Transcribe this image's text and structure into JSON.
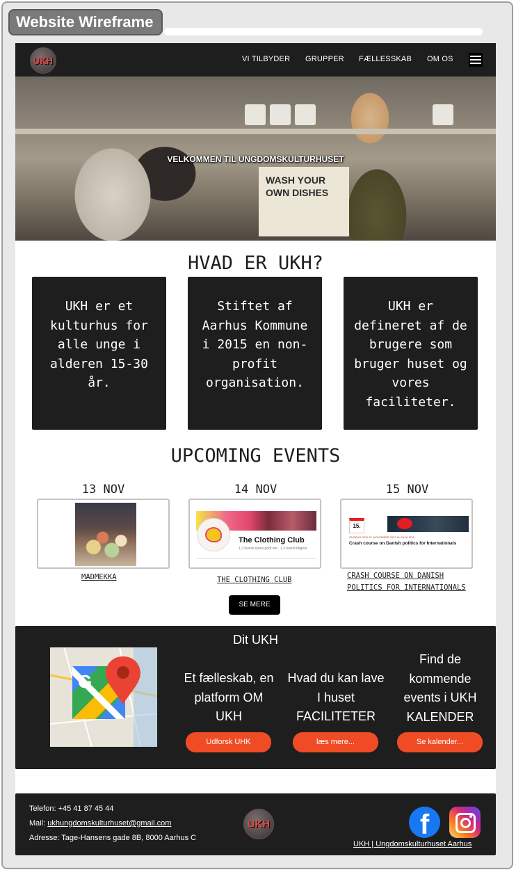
{
  "wireframe": {
    "label": "Website Wireframe"
  },
  "nav": {
    "logo_text": "UKH",
    "links": [
      "VI TILBYDER",
      "GRUPPER",
      "FÆLLESSKAB",
      "OM OS"
    ]
  },
  "hero": {
    "title": "VELKOMMEN TIL UNGDOMSKULTURHUSET",
    "sign_text": "WASH YOUR OWN DISHES"
  },
  "about": {
    "title": "HVAD ER UKH?",
    "boxes": [
      "UKH er et kulturhus for alle unge i alderen 15-30 år.",
      "Stiftet af Aarhus Kommune i 2015 en non-profit organisation.",
      "UKH er defineret af de brugere som bruger huset og vores faciliteter."
    ]
  },
  "events": {
    "title": "UPCOMING EVENTS",
    "items": [
      {
        "date": "13 NOV",
        "name": "MADMEKKA"
      },
      {
        "date": "14 NOV",
        "name": "THE CLOTHING CLUB",
        "card_title": "The Clothing Club",
        "card_sub": "1,3 tusind synes godt om · 1,3 tusind følgere"
      },
      {
        "date": "15 NOV",
        "name": "CRASH COURSE ON DANISH POLITICS FOR INTERNATIONALS",
        "card_day": "15.",
        "card_meta": "ONSDAG DEN 15. NOVEMBER 2023 KL.18:00 FRA",
        "card_title": "Crash course on Danish politics for Internationals"
      }
    ],
    "more_button": "SE MERE"
  },
  "dit_ukh": {
    "title": "Dit UKH",
    "columns": [
      {
        "text": "Et fælleskab, en platform OM UKH",
        "button": "Udforsk UHK"
      },
      {
        "text": "Hvad du kan lave I huset FACILITETER",
        "button": "læs mere..."
      },
      {
        "text": "Find de kommende events i UKH KALENDER",
        "button": "Se kalender..."
      }
    ]
  },
  "footer": {
    "phone": "Telefon: +45 41 87 45 44",
    "mail_label": "Mail: ",
    "mail": "ukhungdomskulturhuset@gmail.com",
    "address": "Adresse: Tage-Hansens gade 8B, 8000 Aarhus C",
    "logo_text": "UKH",
    "site_link": "UKH | Ungdomskulturhuset Aarhus"
  },
  "colors": {
    "dark": "#1e1e1e",
    "accent": "#ef4c26",
    "logo_red": "#e34848"
  }
}
